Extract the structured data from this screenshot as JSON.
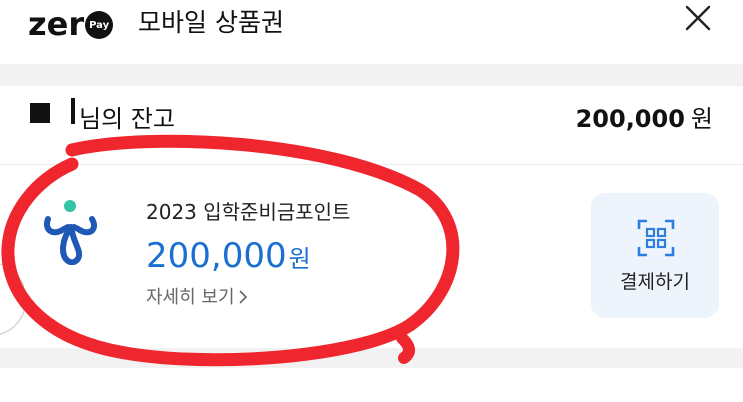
{
  "header": {
    "logo_word": "zer",
    "logo_badge": "Pay",
    "title": "모바일 상품권"
  },
  "balance": {
    "owner_label": "님의 잔고",
    "amount": "200,000",
    "unit": "원"
  },
  "voucher": {
    "name": "2023 입학준비금포인트",
    "amount": "200,000",
    "unit": "원",
    "detail_link": "자세히 보기",
    "pay_label": "결제하기"
  },
  "colors": {
    "accent_blue": "#1b6fd0",
    "annotation_red": "#f0262e",
    "pay_button_bg": "#eef4fb"
  },
  "icons": [
    "close-icon",
    "voucher-logo-icon",
    "qr-scan-icon",
    "chevron-right-icon"
  ]
}
